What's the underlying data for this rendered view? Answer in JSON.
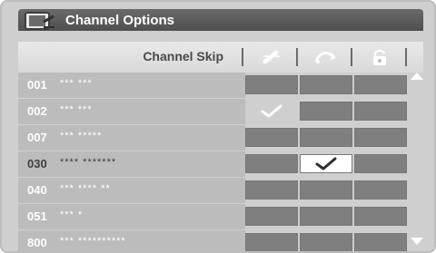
{
  "window": {
    "title": "Channel Options",
    "title_icon": "tv-settings-icon"
  },
  "header": {
    "channel_skip_label": "Channel Skip",
    "col_icons": [
      "remove-channel-icon",
      "jump-channel-icon",
      "unlock-icon"
    ]
  },
  "rows": [
    {
      "num": "001",
      "name": "*** ***",
      "checks": [
        false,
        false,
        false
      ],
      "current": false
    },
    {
      "num": "002",
      "name": "*** ***",
      "checks": [
        true,
        false,
        false
      ],
      "current": false
    },
    {
      "num": "007",
      "name": "*** *****",
      "checks": [
        false,
        false,
        false
      ],
      "current": false
    },
    {
      "num": "030",
      "name": "**** *******",
      "checks": [
        false,
        true,
        false
      ],
      "current": true
    },
    {
      "num": "040",
      "name": "*** **** **",
      "checks": [
        false,
        false,
        false
      ],
      "current": false
    },
    {
      "num": "051",
      "name": "*** *",
      "checks": [
        false,
        false,
        false
      ],
      "current": false
    },
    {
      "num": "800",
      "name": "*** **********",
      "checks": [
        false,
        false,
        false
      ],
      "current": false
    }
  ],
  "scrollbar": {
    "up_icon": "scroll-up-icon",
    "down_icon": "scroll-down-icon"
  },
  "colors": {
    "title_bar": "#5a5a5a",
    "cell": "#7f7f7f",
    "checked_cell": "#ffffff",
    "row": "#bcbcbc"
  }
}
